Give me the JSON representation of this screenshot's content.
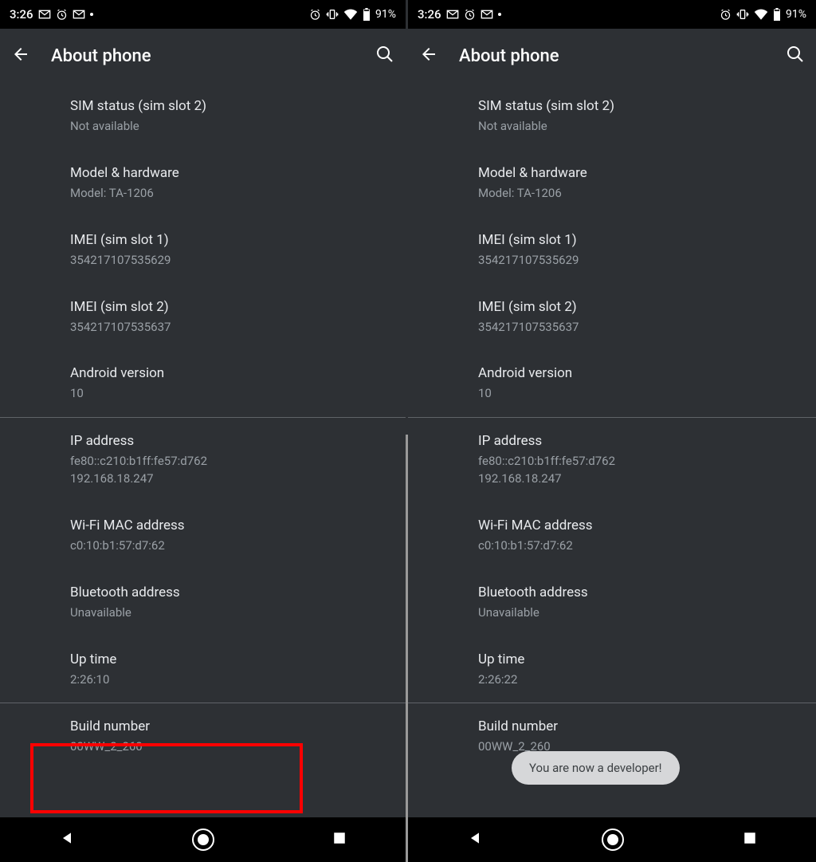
{
  "left": {
    "status": {
      "time": "3:26",
      "battery": "91%"
    },
    "title": "About phone",
    "items": [
      {
        "label": "SIM status (sim slot 2)",
        "value": "Not available"
      },
      {
        "label": "Model & hardware",
        "value": "Model: TA-1206"
      },
      {
        "label": "IMEI (sim slot 1)",
        "value": "354217107535629"
      },
      {
        "label": "IMEI (sim slot 2)",
        "value": "354217107535637"
      },
      {
        "label": "Android version",
        "value": "10"
      }
    ],
    "items2": [
      {
        "label": "IP address",
        "value": "fe80::c210:b1ff:fe57:d762\n192.168.18.247"
      },
      {
        "label": "Wi-Fi MAC address",
        "value": "c0:10:b1:57:d7:62"
      },
      {
        "label": "Bluetooth address",
        "value": "Unavailable"
      },
      {
        "label": "Up time",
        "value": "2:26:10"
      }
    ],
    "build": {
      "label": "Build number",
      "value": "00WW_2_260"
    }
  },
  "right": {
    "status": {
      "time": "3:26",
      "battery": "91%"
    },
    "title": "About phone",
    "items": [
      {
        "label": "SIM status (sim slot 2)",
        "value": "Not available"
      },
      {
        "label": "Model & hardware",
        "value": "Model: TA-1206"
      },
      {
        "label": "IMEI (sim slot 1)",
        "value": "354217107535629"
      },
      {
        "label": "IMEI (sim slot 2)",
        "value": "354217107535637"
      },
      {
        "label": "Android version",
        "value": "10"
      }
    ],
    "items2": [
      {
        "label": "IP address",
        "value": "fe80::c210:b1ff:fe57:d762\n192.168.18.247"
      },
      {
        "label": "Wi-Fi MAC address",
        "value": "c0:10:b1:57:d7:62"
      },
      {
        "label": "Bluetooth address",
        "value": "Unavailable"
      },
      {
        "label": "Up time",
        "value": "2:26:22"
      }
    ],
    "build": {
      "label": "Build number",
      "value": "00WW_2_260"
    },
    "toast": "You are now a developer!"
  }
}
